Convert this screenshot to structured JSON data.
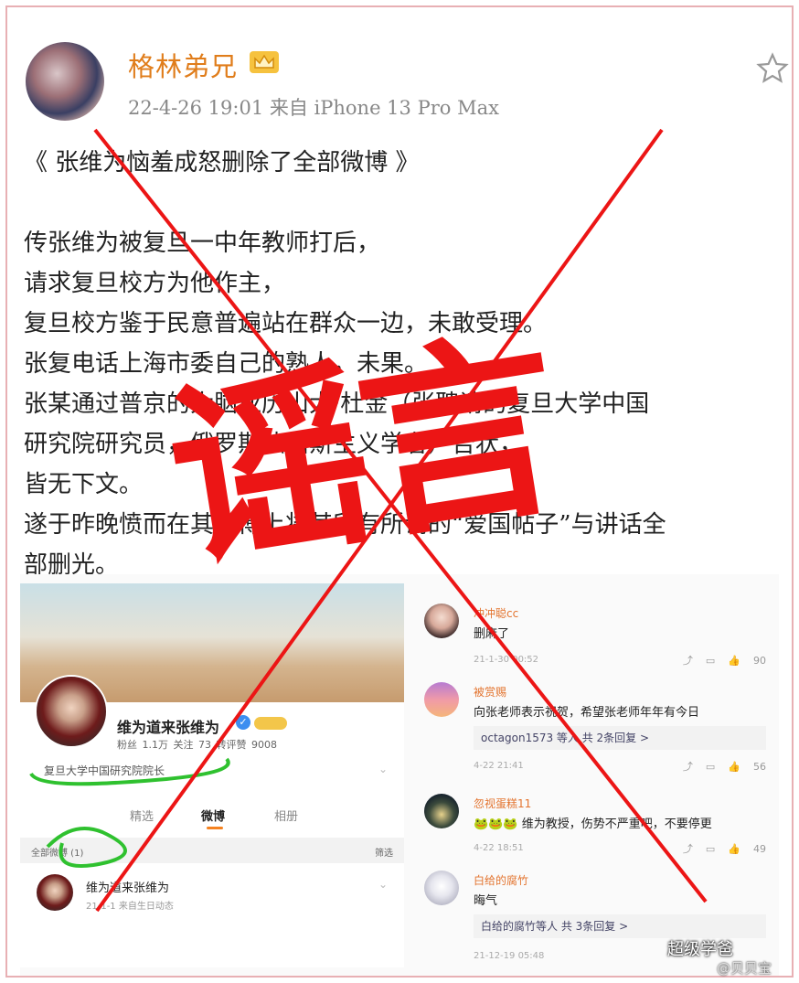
{
  "post": {
    "author": "格林弟兄",
    "meta": "22-4-26 19:01  来自 iPhone 13 Pro Max",
    "lines": [
      "《 张维为恼羞成怒删除了全部微博 》",
      "",
      "传张维为被复旦一中年教师打后，",
      "请求复旦校方为他作主，",
      "复旦校方鉴于民意普遍站在群众一边，未敢受理。",
      "张复电话上海市委自己的熟人，未果。",
      "张某通过普京的大脑亚历山大·杜金（张聘请的复旦大学中国",
      "研究院研究员，俄罗斯法西斯主义学者）告状，",
      "皆无下文。",
      "遂于昨晚愤而在其微博上将其所有所谓的“爱国帖子”与讲话全",
      "部删光。"
    ]
  },
  "embedded_profile": {
    "name": "维为道来张维为",
    "stats": "粉丝 1.1万  关注 73  转评赞 9008",
    "title": "复旦大学中国研究院院长",
    "tabs": [
      "精选",
      "微博",
      "相册"
    ],
    "active_tab": "微博",
    "filter_left": "全部微博 (1)",
    "filter_right": "筛选",
    "item_name": "维为道来张维为",
    "item_time": "21-1-1 来自生日动态"
  },
  "comments": [
    {
      "name": "冲冲聪cc",
      "text": "删麻了",
      "time": "21-1-30 00:52",
      "likes": "90",
      "reply": ""
    },
    {
      "name": "被赏赐",
      "text": "向张老师表示祝贺，希望张老师年年有今日",
      "time": "4-22 21:41",
      "likes": "56",
      "reply": "octagon1573 等人  共 2条回复 >"
    },
    {
      "name": "忽视蛋糕11",
      "text": "🐸🐸🐸 维为教授，伤势不严重吧，不要停更",
      "time": "4-22 18:51",
      "likes": "49",
      "reply": ""
    },
    {
      "name": "白给的腐竹",
      "text": "晦气",
      "time": "21-12-19 05:48",
      "likes": "",
      "reply": "白给的腐竹等人  共 3条回复 >"
    }
  ],
  "stamp_text": "谣言",
  "watermark": {
    "main": "超级学爸",
    "sub": "@贝贝宝"
  },
  "colors": {
    "stamp": "#ec1515",
    "author": "#e07d1b",
    "border": "#e8b0b4"
  },
  "icons": [
    "crown-icon",
    "star-icon",
    "verify-icon"
  ]
}
